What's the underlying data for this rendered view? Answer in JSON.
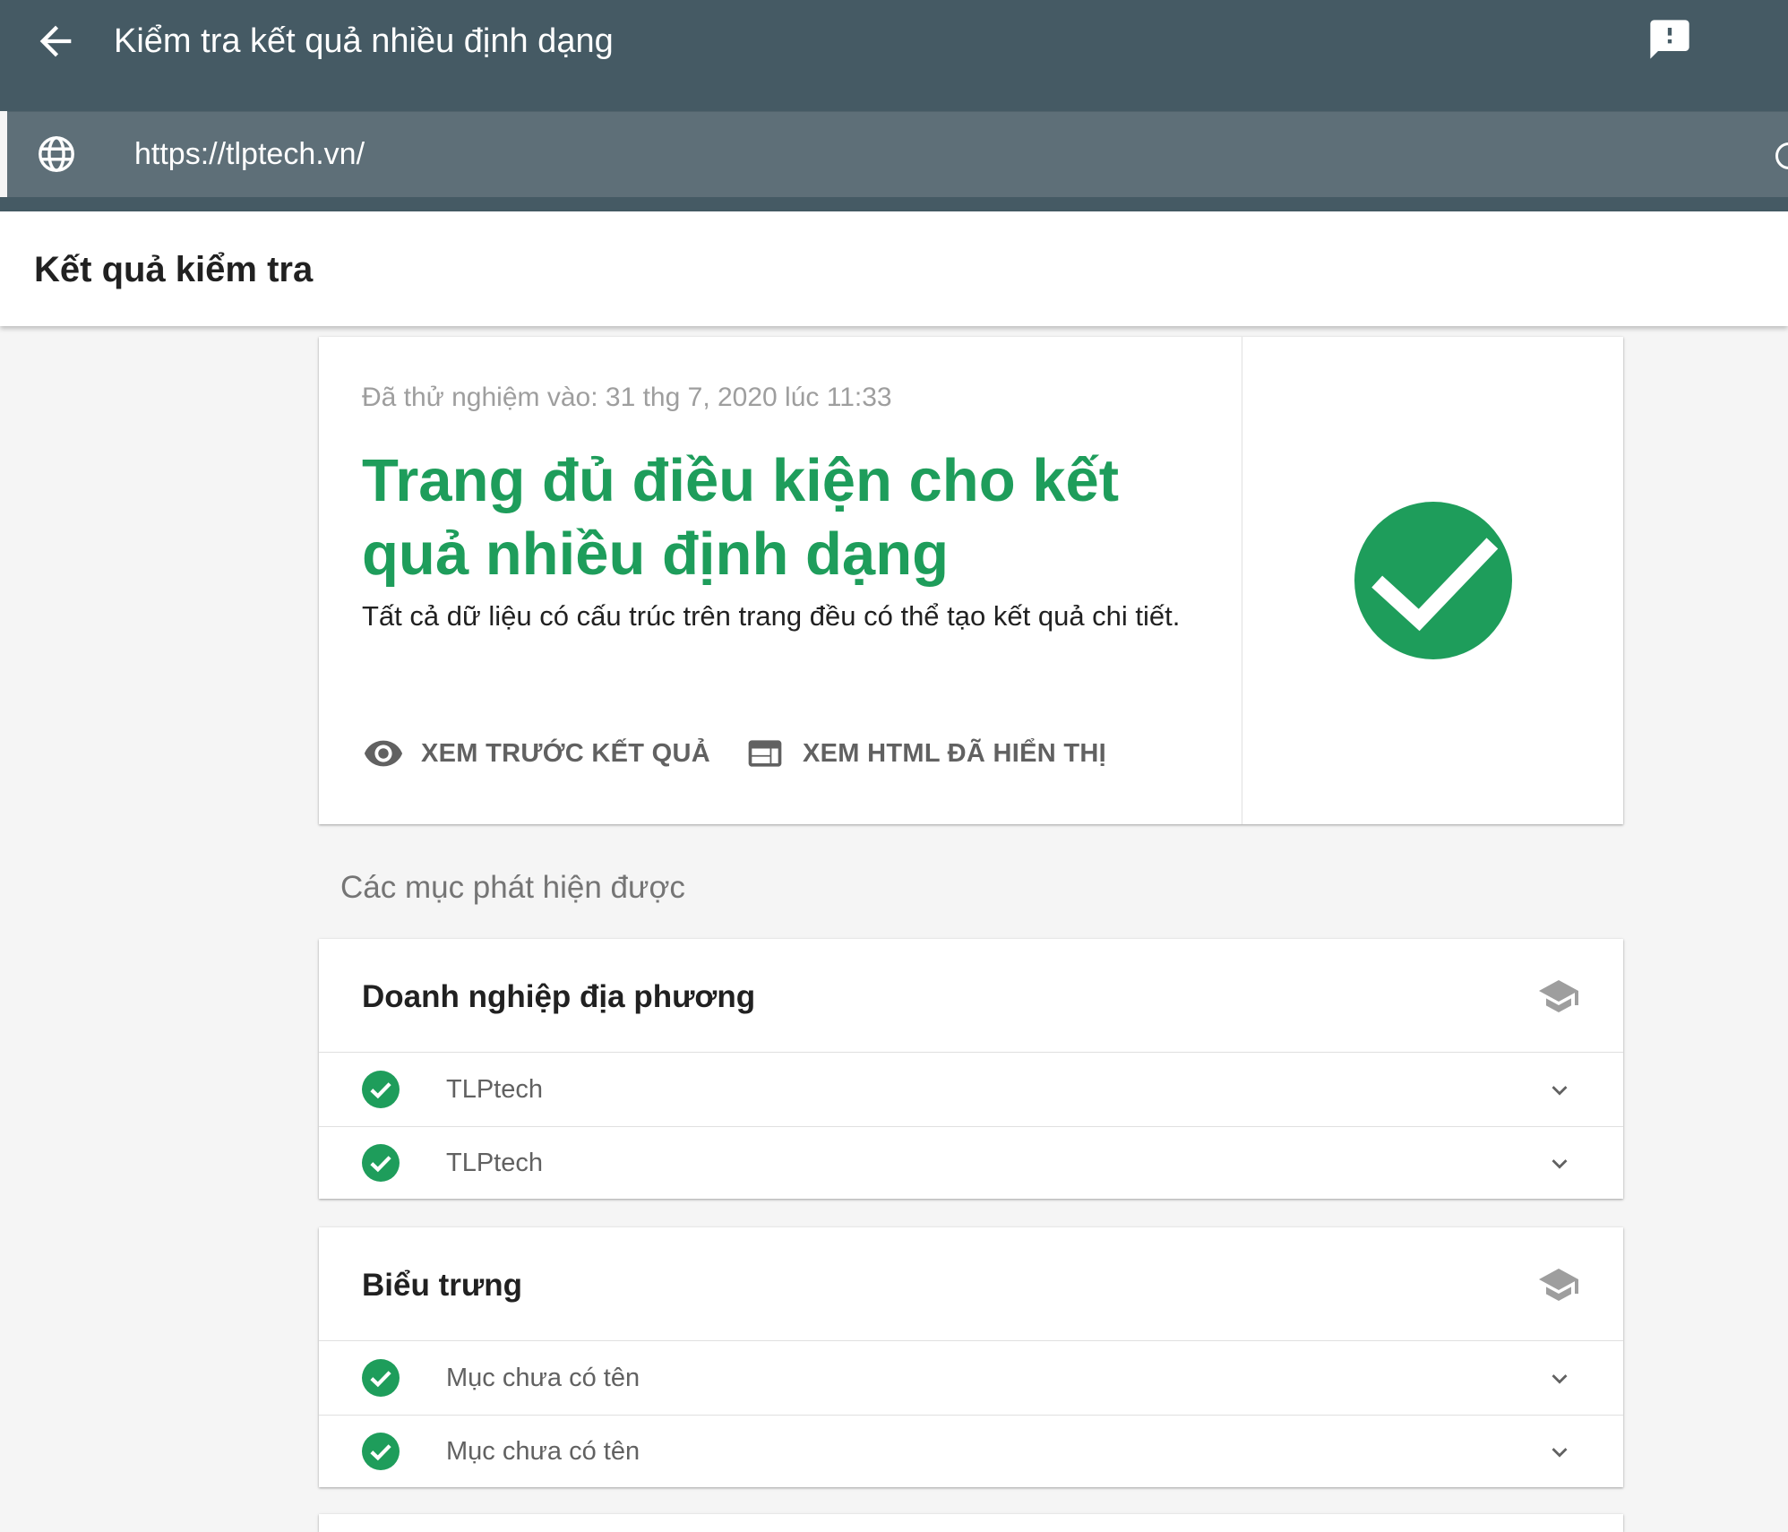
{
  "appbar": {
    "title": "Kiểm tra kết quả nhiều định dạng",
    "back_icon": "arrow-back-icon",
    "feedback_icon": "feedback-icon"
  },
  "urlbar": {
    "url": "https://tlptech.vn/",
    "icon": "globe-icon"
  },
  "results": {
    "title": "Kết quả kiểm tra"
  },
  "summary": {
    "tested_on": "Đã thử nghiệm vào: 31 thg 7, 2020 lúc 11:33",
    "headline": "Trang đủ điều kiện cho kết quả nhiều định dạng",
    "description": "Tất cả dữ liệu có cấu trúc trên trang đều có thể tạo kết quả chi tiết.",
    "actions": [
      {
        "label": "XEM TRƯỚC KẾT QUẢ",
        "icon": "eye-icon"
      },
      {
        "label": "XEM HTML ĐÃ HIỂN THỊ",
        "icon": "web-window-icon"
      }
    ],
    "status_icon": "check-circle-icon",
    "accent_color": "#1e9d5b"
  },
  "detected": {
    "title": "Các mục phát hiện được",
    "groups": [
      {
        "title": "Doanh nghiệp địa phương",
        "icon": "school-icon",
        "items": [
          {
            "label": "TLPtech"
          },
          {
            "label": "TLPtech"
          }
        ]
      },
      {
        "title": "Biểu trưng",
        "icon": "school-icon",
        "items": [
          {
            "label": "Mục chưa có tên"
          },
          {
            "label": "Mục chưa có tên"
          }
        ]
      }
    ]
  },
  "colors": {
    "appbar": "#455a64",
    "urlbar": "#5e6f78",
    "success": "#1e9d5b",
    "background": "#f5f5f5"
  }
}
